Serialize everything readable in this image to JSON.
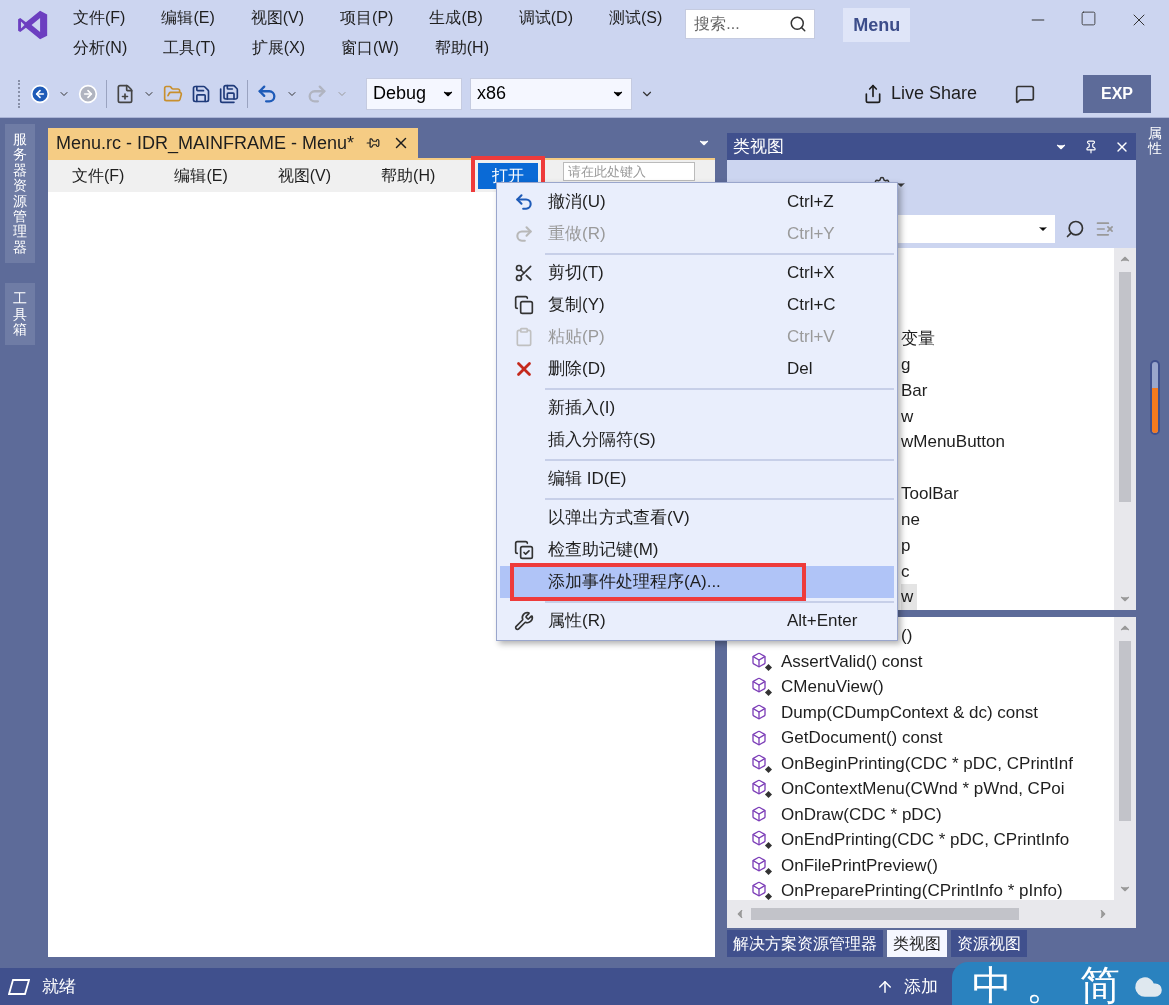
{
  "title_bar": {
    "menu_rows": [
      [
        "文件(F)",
        "编辑(E)",
        "视图(V)",
        "项目(P)",
        "生成(B)",
        "调试(D)",
        "测试(S)"
      ],
      [
        "分析(N)",
        "工具(T)",
        "扩展(X)",
        "窗口(W)",
        "帮助(H)"
      ]
    ],
    "search": {
      "placeholder": "搜索..."
    },
    "solution": "Menu"
  },
  "toolbar": {
    "configuration": "Debug",
    "platform": "x86",
    "live_share": "Live Share",
    "badge": "EXP"
  },
  "left_tabs": [
    "服务器资源管理器",
    "工具箱"
  ],
  "document": {
    "tab": {
      "title": "Menu.rc - IDR_MAINFRAME - Menu*"
    },
    "menu_items": [
      {
        "label": "文件(F)",
        "selected": false,
        "annotated": false
      },
      {
        "label": "编辑(E)",
        "selected": false,
        "annotated": false
      },
      {
        "label": "视图(V)",
        "selected": false,
        "annotated": false
      },
      {
        "label": "帮助(H)",
        "selected": false,
        "annotated": false
      },
      {
        "label": "打开",
        "selected": true,
        "annotated": true
      }
    ],
    "new_item": {
      "placeholder": "请在此处键入"
    }
  },
  "context_menu": {
    "items": [
      {
        "kind": "item",
        "label": "撤消(U)",
        "shortcut": "Ctrl+Z",
        "disabled": false,
        "selected": false,
        "annotated": false
      },
      {
        "kind": "item",
        "label": "重做(R)",
        "shortcut": "Ctrl+Y",
        "disabled": true,
        "selected": false,
        "annotated": false
      },
      {
        "kind": "separator"
      },
      {
        "kind": "item",
        "label": "剪切(T)",
        "shortcut": "Ctrl+X",
        "disabled": false,
        "selected": false,
        "annotated": false
      },
      {
        "kind": "item",
        "label": "复制(Y)",
        "shortcut": "Ctrl+C",
        "disabled": false,
        "selected": false,
        "annotated": false
      },
      {
        "kind": "item",
        "label": "粘贴(P)",
        "shortcut": "Ctrl+V",
        "disabled": true,
        "selected": false,
        "annotated": false
      },
      {
        "kind": "item",
        "label": "删除(D)",
        "shortcut": "Del",
        "disabled": false,
        "selected": false,
        "annotated": false
      },
      {
        "kind": "separator"
      },
      {
        "kind": "item",
        "label": "新插入(I)",
        "disabled": false,
        "selected": false,
        "annotated": false
      },
      {
        "kind": "item",
        "label": "插入分隔符(S)",
        "disabled": false,
        "selected": false,
        "annotated": false
      },
      {
        "kind": "separator"
      },
      {
        "kind": "item",
        "label": "编辑 ID(E)",
        "disabled": false,
        "selected": false,
        "annotated": false
      },
      {
        "kind": "separator"
      },
      {
        "kind": "item",
        "label": "以弹出方式查看(V)",
        "disabled": false,
        "selected": false,
        "annotated": false
      },
      {
        "kind": "item",
        "label": "检查助记键(M)",
        "disabled": false,
        "selected": false,
        "annotated": false
      },
      {
        "kind": "item",
        "label": "添加事件处理程序(A)...",
        "disabled": false,
        "selected": true,
        "annotated": true
      },
      {
        "kind": "separator"
      },
      {
        "kind": "item",
        "label": "属性(R)",
        "shortcut": "Alt+Enter",
        "disabled": false,
        "selected": false,
        "annotated": false
      }
    ]
  },
  "class_view": {
    "title": "类视图",
    "tree_fragments": [
      {
        "text": "变量",
        "selected": false
      },
      {
        "text": "g",
        "selected": false
      },
      {
        "text": "Bar",
        "selected": false
      },
      {
        "text": "w",
        "selected": false
      },
      {
        "text": "wMenuButton",
        "selected": false
      },
      {
        "text": "ToolBar",
        "selected": false
      },
      {
        "text": "ne",
        "selected": false
      },
      {
        "text": "p",
        "selected": false
      },
      {
        "text": "c",
        "selected": false
      },
      {
        "text": "w",
        "selected": true
      }
    ],
    "members": [
      {
        "kind": "fragment",
        "name": "()"
      },
      {
        "kind": "member",
        "name": "AssertValid() const",
        "starred": true
      },
      {
        "kind": "member",
        "name": "CMenuView()",
        "starred": true
      },
      {
        "kind": "member",
        "name": "Dump(CDumpContext & dc) const",
        "starred": false
      },
      {
        "kind": "member",
        "name": "GetDocument() const",
        "starred": false
      },
      {
        "kind": "member",
        "name": "OnBeginPrinting(CDC * pDC, CPrintInf",
        "starred": true
      },
      {
        "kind": "member",
        "name": "OnContextMenu(CWnd * pWnd, CPoi",
        "starred": true
      },
      {
        "kind": "member",
        "name": "OnDraw(CDC * pDC)",
        "starred": false
      },
      {
        "kind": "member",
        "name": "OnEndPrinting(CDC * pDC, CPrintInfo",
        "starred": true
      },
      {
        "kind": "member",
        "name": "OnFilePrintPreview()",
        "starred": true
      },
      {
        "kind": "member",
        "name": "OnPreparePrinting(CPrintInfo * pInfo)",
        "starred": true
      }
    ],
    "tabs": [
      {
        "label": "解决方案资源管理器",
        "selected": false
      },
      {
        "label": "类视图",
        "selected": true
      },
      {
        "label": "资源视图",
        "selected": false
      }
    ]
  },
  "right_tabs": [
    "属性"
  ],
  "status_bar": {
    "text": "就绪",
    "action": "添加"
  },
  "ime": {
    "mode": "中",
    "punctuation": "。",
    "script": "简"
  }
}
